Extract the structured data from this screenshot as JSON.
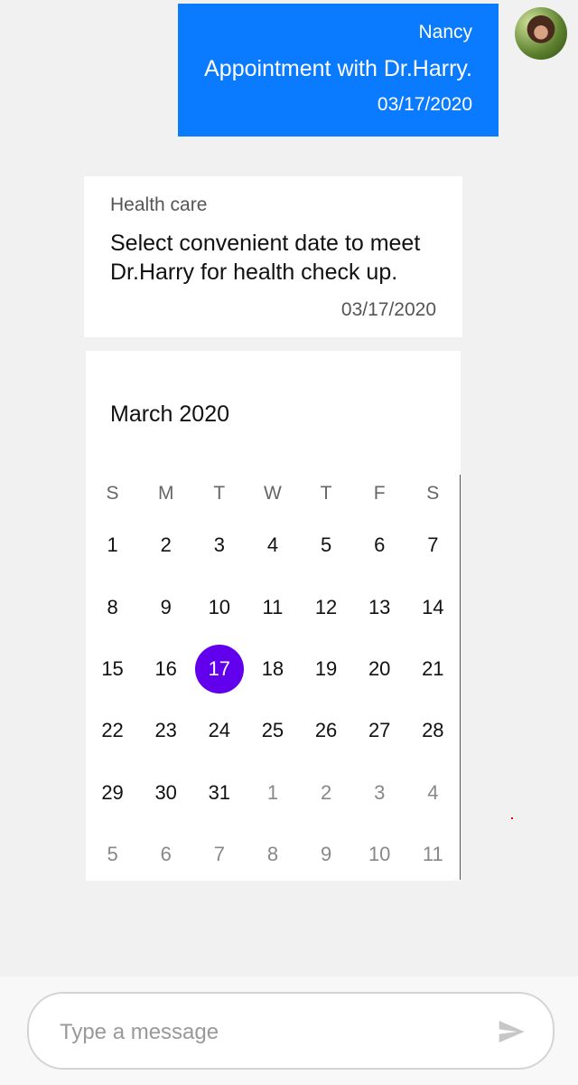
{
  "outgoing": {
    "sender": "Nancy",
    "text": "Appointment with Dr.Harry.",
    "time": "03/17/2020",
    "bubble_color": "#0a7bff"
  },
  "incoming": {
    "sender": "Health care",
    "text": "Select convenient date to meet Dr.Harry for health check up.",
    "time": "03/17/2020"
  },
  "calendar": {
    "title": "March 2020",
    "weekdays": [
      "S",
      "M",
      "T",
      "W",
      "T",
      "F",
      "S"
    ],
    "weeks": [
      [
        "1",
        "2",
        "3",
        "4",
        "5",
        "6",
        "7"
      ],
      [
        "8",
        "9",
        "10",
        "11",
        "12",
        "13",
        "14"
      ],
      [
        "15",
        "16",
        "17",
        "18",
        "19",
        "20",
        "21"
      ],
      [
        "22",
        "23",
        "24",
        "25",
        "26",
        "27",
        "28"
      ],
      [
        "29",
        "30",
        "31",
        "1",
        "2",
        "3",
        "4"
      ],
      [
        "5",
        "6",
        "7",
        "8",
        "9",
        "10",
        "11"
      ]
    ],
    "selected_day": "17",
    "selected_color": "#6200ee"
  },
  "composer": {
    "placeholder": "Type a message",
    "send_icon": "send-icon"
  }
}
